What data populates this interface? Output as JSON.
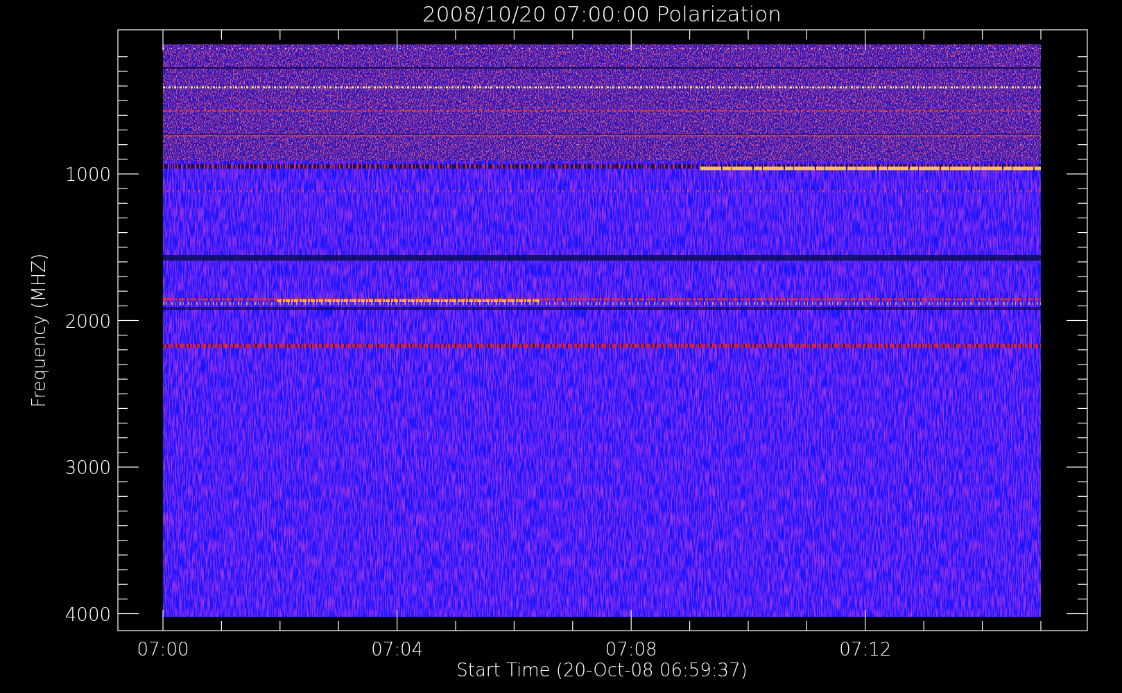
{
  "title": "2008/10/20 07:00:00 Polarization",
  "y_axis": {
    "label": "Frequency (MHZ)",
    "ticks": [
      "1000",
      "2000",
      "3000",
      "4000"
    ]
  },
  "x_axis": {
    "label": "Start Time (20-Oct-08 06:59:37)",
    "ticks": [
      "07:00",
      "07:04",
      "07:08",
      "07:12"
    ]
  }
}
